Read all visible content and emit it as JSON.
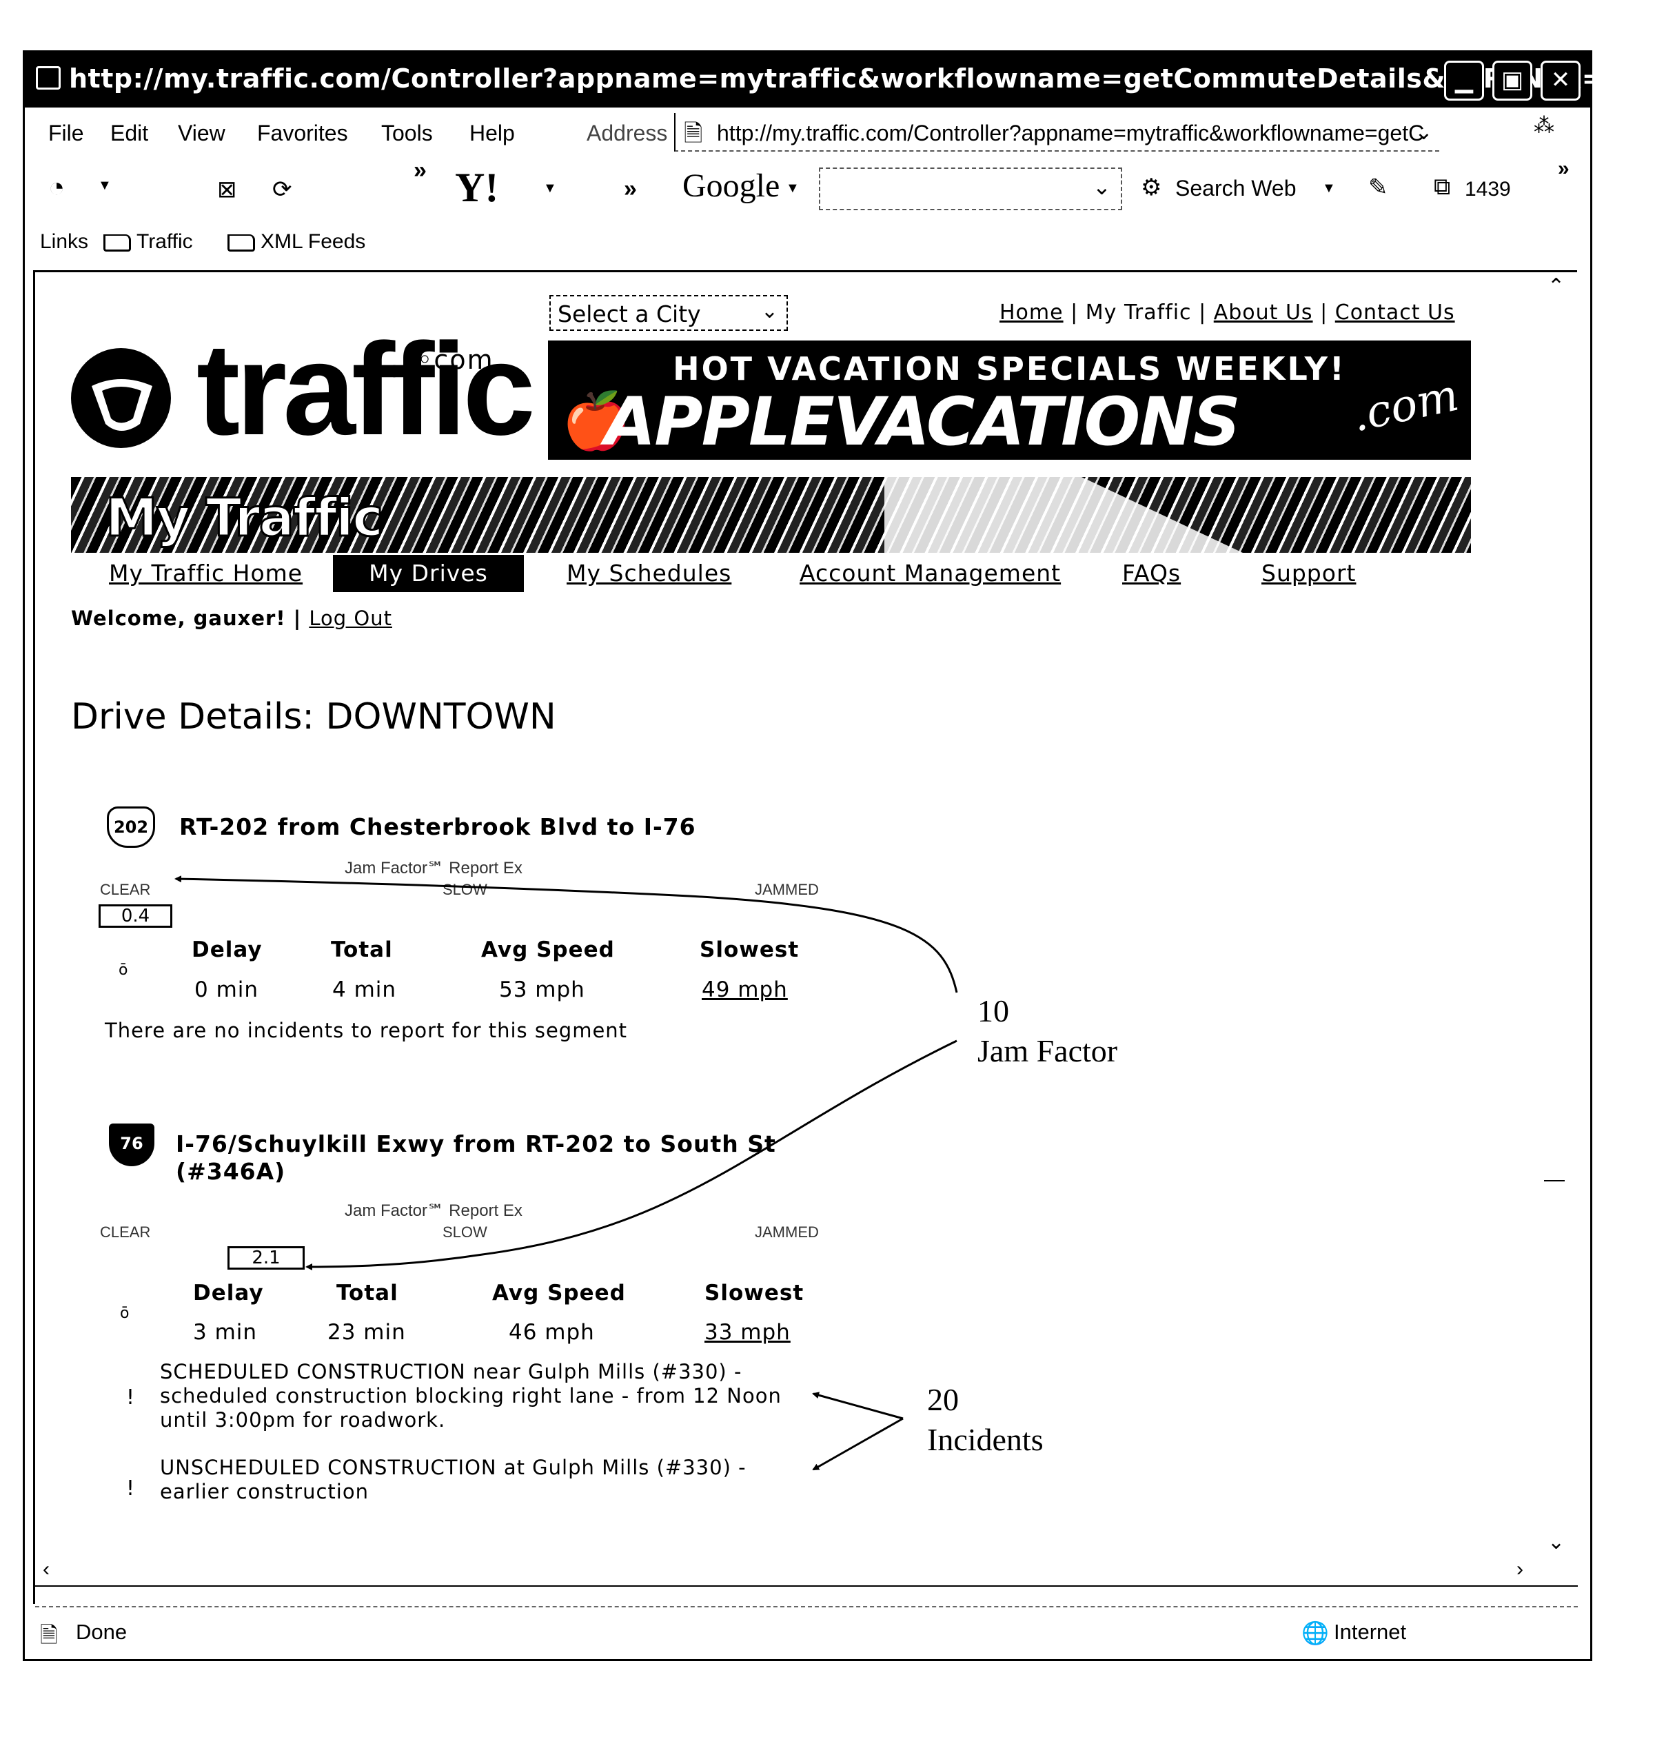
{
  "browser": {
    "title": "http://my.traffic.com/Controller?appname=mytraffic&workflowname=getCommuteDetails&PARTNER=DEF...",
    "menu": [
      "File",
      "Edit",
      "View",
      "Favorites",
      "Tools",
      "Help"
    ],
    "address_label": "Address",
    "address_value": "http://my.traffic.com/Controller?appname=mytraffic&workflowname=getC",
    "toolbar": {
      "yahoo": "Y!",
      "chevron": "»",
      "google": "Google",
      "search_value": "",
      "search_web": "Search Web",
      "popup_count": "1439"
    },
    "links_label": "Links",
    "links": [
      "Traffic",
      "XML Feeds"
    ],
    "status": "Done",
    "zone": "Internet"
  },
  "site": {
    "city_select": "Select a City",
    "top_links": [
      "Home",
      "My Traffic",
      "About Us",
      "Contact Us"
    ],
    "logo": {
      "name": "traffic",
      "suffix": "com"
    },
    "ad": {
      "headline": "HOT VACATION SPECIALS WEEKLY!",
      "brand": "APPLEVACATIONS",
      "brand_suffix": ".com"
    },
    "banner_title": "My Traffic",
    "nav": [
      "My Traffic Home",
      "My Drives",
      "My Schedules",
      "Account Management",
      "FAQs",
      "Support"
    ],
    "nav_active": "My Drives",
    "welcome": "Welcome, gauxer!",
    "logout": "Log Out"
  },
  "page": {
    "title": "Drive Details: DOWNTOWN",
    "columns": [
      "Delay",
      "Total",
      "Avg Speed",
      "Slowest"
    ],
    "jam_caption": "Jam Factor℠ Report Ex",
    "jam_scale": [
      "CLEAR",
      "SLOW",
      "JAMMED"
    ],
    "segments": [
      {
        "shield": "202",
        "shield_type": "us-route",
        "title": "RT-202 from Chesterbrook Blvd to I-76",
        "jam_factor": "0.4",
        "delay": "0 min",
        "total": "4 min",
        "avg_speed": "53 mph",
        "slowest": "49 mph",
        "incidents_text": "There are no incidents to report for this segment",
        "incidents": []
      },
      {
        "shield": "76",
        "shield_type": "interstate",
        "title": "I-76/Schuylkill Exwy from RT-202 to South St",
        "title_line2": "(#346A)",
        "jam_factor": "2.1",
        "delay": "3 min",
        "total": "23 min",
        "avg_speed": "46 mph",
        "slowest": "33 mph",
        "incidents": [
          "SCHEDULED CONSTRUCTION near Gulph Mills (#330) -\nscheduled construction blocking right lane - from 12 Noon\nuntil 3:00pm for roadwork.",
          "UNSCHEDULED CONSTRUCTION at Gulph Mills (#330) -\nearlier construction"
        ]
      }
    ]
  },
  "annotations": [
    {
      "number": "10",
      "label": "Jam Factor"
    },
    {
      "number": "20",
      "label": "Incidents"
    }
  ]
}
